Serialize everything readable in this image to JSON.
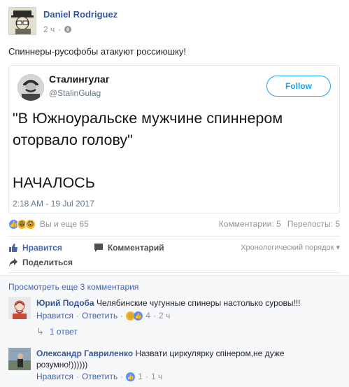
{
  "post": {
    "author": "Daniel Rodriguez",
    "time": "2 ч",
    "privacy_icon": "globe-icon",
    "text": "Спиннеры-русофобы атакуют россиюшку!"
  },
  "tweet": {
    "name": "Сталингулаг",
    "handle": "@StalinGulag",
    "follow_label": "Follow",
    "text_line1": "\"В Южноуральске мужчине спиннером оторвало голову\"",
    "text_line2": "НАЧАЛОСЬ",
    "timestamp": "2:18 AM - 19 Jul 2017",
    "accent": "#1da1f2"
  },
  "reactions": {
    "summary": "Вы и еще 65",
    "comments_count": "Комментарии: 5",
    "shares_count": "Перепосты: 5"
  },
  "actions": {
    "like": "Нравится",
    "comment": "Комментарий",
    "share": "Поделиться",
    "order": "Хронологический порядок ▾"
  },
  "comments": {
    "view_more": "Просмотреть еще 3 комментария",
    "items": [
      {
        "author": "Юрий Подоба",
        "text": "Челябинские чугунные спинеры настолько суровы!!!",
        "like": "Нравится",
        "reply": "Ответить",
        "reactions": "4",
        "time": "2 ч",
        "replies": "1 ответ"
      },
      {
        "author": "Олександр Гавриленко",
        "text_line1": "Назвати циркулярку спінером,не дуже",
        "text_line2": "розумно!))))))",
        "like": "Нравится",
        "reply": "Ответить",
        "reactions": "1",
        "time": "1 ч"
      }
    ]
  },
  "colors": {
    "link": "#365899",
    "fb_blue": "#4267b2",
    "meta_gray": "#90949c"
  }
}
